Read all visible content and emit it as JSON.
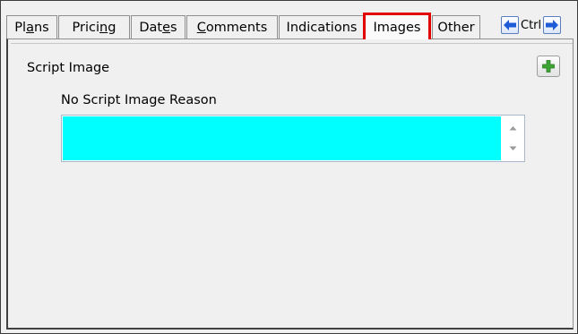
{
  "tabs": [
    {
      "pre": "Pl",
      "mn": "a",
      "post": "ns"
    },
    {
      "pre": "Prici",
      "mn": "n",
      "post": "g"
    },
    {
      "pre": "Dat",
      "mn": "e",
      "post": "s"
    },
    {
      "pre": "",
      "mn": "C",
      "post": "omments"
    },
    {
      "pre": "Indications",
      "mn": "",
      "post": ""
    },
    {
      "pre": "Images",
      "mn": "",
      "post": ""
    },
    {
      "pre": "Other",
      "mn": "",
      "post": ""
    }
  ],
  "selected_tab": "Images",
  "nav": {
    "ctrl_label": "Ctrl",
    "prev_icon": "arrow-left-icon",
    "next_icon": "arrow-right-icon"
  },
  "content": {
    "section_label": "Script Image",
    "field_label": "No Script Image Reason",
    "field_value": "",
    "field_bg": "#00ffff"
  },
  "add_icon": "plus-icon",
  "colors": {
    "selected_tab_border": "#e10000",
    "arrow_blue": "#1e5bd6",
    "plus_green": "#3ea534"
  }
}
